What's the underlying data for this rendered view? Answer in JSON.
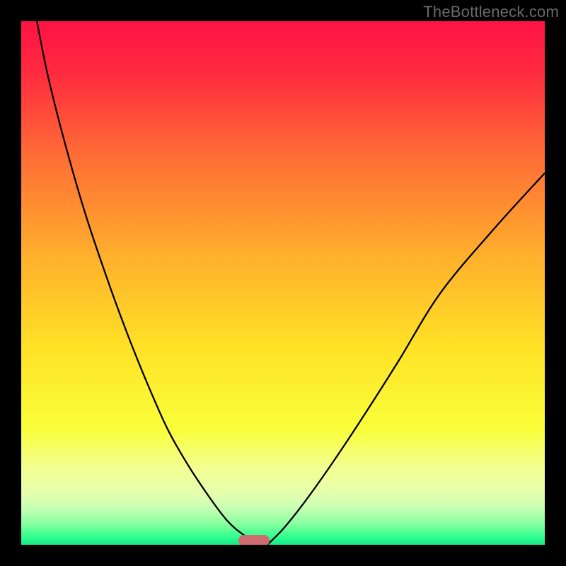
{
  "watermark": "TheBottleneck.com",
  "chart_data": {
    "type": "line",
    "title": "",
    "xlabel": "",
    "ylabel": "",
    "xlim": [
      0,
      100
    ],
    "ylim": [
      0,
      100
    ],
    "series": [
      {
        "name": "curve",
        "x": [
          3,
          5,
          8,
          12,
          16,
          20,
          24,
          28,
          32,
          36,
          39,
          41,
          43,
          44.5
        ],
        "y": [
          100,
          90,
          78,
          64,
          52,
          41,
          31,
          22,
          15,
          9,
          5,
          3,
          1.5,
          0
        ],
        "x2": [
          47,
          50,
          54,
          59,
          65,
          72,
          80,
          90,
          100
        ],
        "y2": [
          0,
          3,
          8,
          15,
          24,
          35,
          48,
          60,
          71
        ]
      }
    ],
    "marker": {
      "x_center": 44.5,
      "width_pct": 6,
      "color": "#cf6b6f"
    },
    "gradient_stops": [
      {
        "offset": 0.0,
        "color": "#ff1345"
      },
      {
        "offset": 0.1,
        "color": "#ff2b3f"
      },
      {
        "offset": 0.25,
        "color": "#ff6a36"
      },
      {
        "offset": 0.45,
        "color": "#ffb02c"
      },
      {
        "offset": 0.62,
        "color": "#ffe126"
      },
      {
        "offset": 0.78,
        "color": "#f9ff3a"
      },
      {
        "offset": 0.85,
        "color": "#f3ff8f"
      },
      {
        "offset": 0.9,
        "color": "#e6ffad"
      },
      {
        "offset": 0.93,
        "color": "#c7ffb3"
      },
      {
        "offset": 0.96,
        "color": "#87ff9f"
      },
      {
        "offset": 0.985,
        "color": "#2fff8e"
      },
      {
        "offset": 1.0,
        "color": "#17e884"
      }
    ]
  }
}
